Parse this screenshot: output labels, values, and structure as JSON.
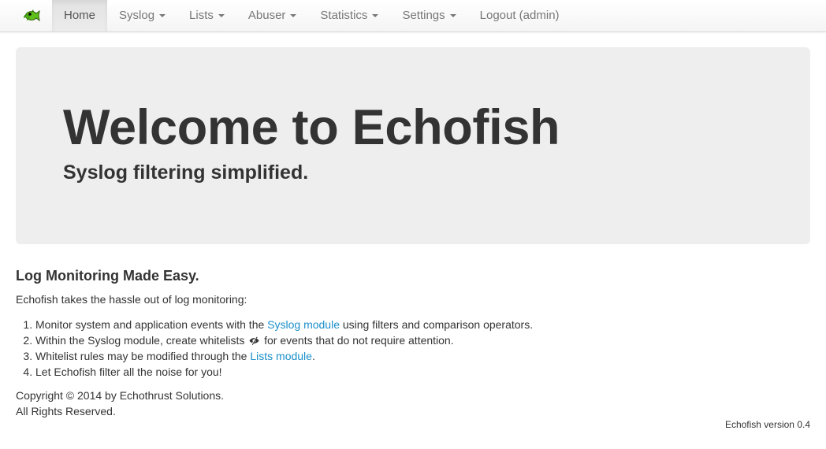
{
  "navbar": {
    "brand_icon": "echofish-logo-icon",
    "items": [
      {
        "label": "Home",
        "active": true,
        "dropdown": false
      },
      {
        "label": "Syslog",
        "active": false,
        "dropdown": true
      },
      {
        "label": "Lists",
        "active": false,
        "dropdown": true
      },
      {
        "label": "Abuser",
        "active": false,
        "dropdown": true
      },
      {
        "label": "Statistics",
        "active": false,
        "dropdown": true
      },
      {
        "label": "Settings",
        "active": false,
        "dropdown": true
      },
      {
        "label": "Logout (admin)",
        "active": false,
        "dropdown": false
      }
    ]
  },
  "jumbotron": {
    "title": "Welcome to Echofish",
    "subtitle": "Syslog filtering simplified."
  },
  "main": {
    "heading": "Log Monitoring Made Easy.",
    "intro": "Echofish takes the hassle out of log monitoring:",
    "steps": [
      {
        "before": "Monitor system and application events with the ",
        "link": "Syslog module",
        "after": " using filters and comparison operators."
      },
      {
        "before": "Within the Syslog module, create whitelists ",
        "icon": "eye-slash-icon",
        "after": " for events that do not require attention."
      },
      {
        "before": "Whitelist rules may be modified through the ",
        "link": "Lists module",
        "after": "."
      },
      {
        "before": "Let Echofish filter all the noise for you!"
      }
    ],
    "copyright_line1": "Copyright © 2014 by Echothrust Solutions.",
    "copyright_line2": "All Rights Reserved."
  },
  "footer": {
    "version": "Echofish version 0.4"
  },
  "colors": {
    "link": "#1a8fc9",
    "jumbotron_bg": "#eeeeee",
    "text": "#333333",
    "nav_text": "#777777"
  }
}
